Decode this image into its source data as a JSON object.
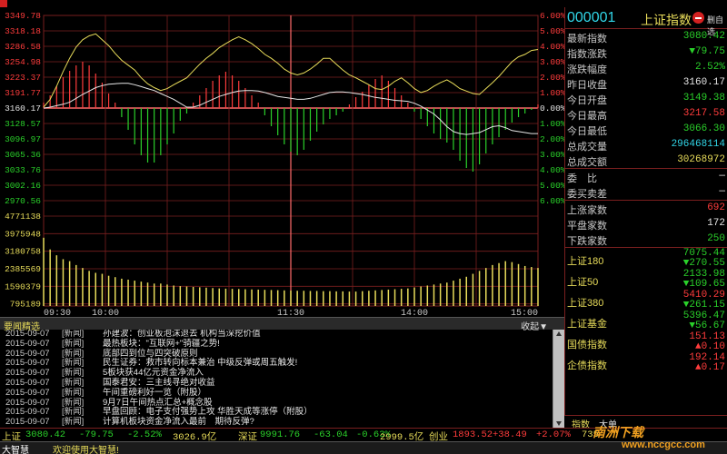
{
  "chart_data": {
    "type": "line",
    "price_axis": [
      "3349.78",
      "3318.18",
      "3286.58",
      "3254.98",
      "3223.37",
      "3191.77",
      "3160.17",
      "3128.57",
      "3096.97",
      "3065.36",
      "3033.76",
      "3002.16",
      "2970.56"
    ],
    "pct_axis": [
      "6.00%",
      "5.00%",
      "4.00%",
      "3.00%",
      "2.00%",
      "1.00%",
      "0.00%",
      "1.00%",
      "2.00%",
      "3.00%",
      "4.00%",
      "5.00%",
      "6.00%"
    ],
    "volume_axis": [
      "4771138",
      "3975948",
      "3180758",
      "2385569",
      "1590379",
      "795189"
    ],
    "time_axis": [
      "09:30",
      "10:00",
      "11:30",
      "14:00",
      "15:00"
    ],
    "ylim": [
      2970.56,
      3349.78
    ],
    "prev_close": 3160.17,
    "series": [
      {
        "values": [
          3162,
          3178,
          3205,
          3235,
          3262,
          3285,
          3300,
          3308,
          3312,
          3300,
          3288,
          3272,
          3258,
          3248,
          3238,
          3222,
          3210,
          3202,
          3196,
          3200,
          3208,
          3215,
          3222,
          3236,
          3250,
          3262,
          3272,
          3284,
          3292,
          3300,
          3306,
          3300,
          3292,
          3282,
          3270,
          3262,
          3252,
          3240,
          3232,
          3228,
          3232,
          3240,
          3250,
          3262,
          3262,
          3250,
          3238,
          3228,
          3222,
          3215,
          3208,
          3200,
          3198,
          3205,
          3215,
          3222,
          3212,
          3200,
          3192,
          3196,
          3205,
          3212,
          3218,
          3210,
          3200,
          3195,
          3190,
          3188,
          3200,
          3212,
          3225,
          3240,
          3255,
          3265,
          3270,
          3278,
          3280
        ]
      },
      {
        "values": [
          3160,
          3162,
          3165,
          3168,
          3172,
          3180,
          3188,
          3195,
          3202,
          3206,
          3209,
          3210,
          3211,
          3211,
          3208,
          3204,
          3200,
          3196,
          3190,
          3184,
          3178,
          3170,
          3162,
          3162,
          3166,
          3172,
          3178,
          3184,
          3188,
          3192,
          3195,
          3196,
          3196,
          3195,
          3192,
          3188,
          3184,
          3182,
          3180,
          3178,
          3178,
          3180,
          3184,
          3188,
          3192,
          3193,
          3193,
          3192,
          3190,
          3188,
          3185,
          3182,
          3180,
          3178,
          3176,
          3175,
          3174,
          3170,
          3164,
          3156,
          3148,
          3136,
          3122,
          3112,
          3108,
          3106,
          3108,
          3110,
          3116,
          3122,
          3124,
          3120,
          3114,
          3112,
          3110,
          3108,
          3108
        ]
      }
    ],
    "imbalance": [
      6,
      14,
      24,
      34,
      41,
      47,
      51,
      47,
      38,
      28,
      16,
      6,
      -10,
      -24,
      -40,
      -52,
      -60,
      -60,
      -52,
      -40,
      -28,
      -14,
      -6,
      6,
      14,
      22,
      30,
      36,
      40,
      36,
      30,
      22,
      14,
      6,
      -8,
      -20,
      -30,
      -40,
      -48,
      -52,
      -46,
      -36,
      -26,
      -18,
      -12,
      -8,
      -4,
      4,
      12,
      18,
      26,
      32,
      36,
      30,
      22,
      14,
      6,
      -4,
      -12,
      -20,
      -28,
      -34,
      -38,
      -46,
      -58,
      -66,
      -70,
      -62,
      -50,
      -40,
      -32,
      -24,
      -16,
      -10,
      -6,
      -2,
      4
    ],
    "volume": [
      3500000,
      2900000,
      2600000,
      2400000,
      2300000,
      2100000,
      1950000,
      1800000,
      1700000,
      1650000,
      1550000,
      1480000,
      1400000,
      1350000,
      1300000,
      1250000,
      1200000,
      1150000,
      1150000,
      1100000,
      1050000,
      1020000,
      1000000,
      980000,
      960000,
      940000,
      920000,
      900000,
      890000,
      880000,
      870000,
      860000,
      850000,
      840000,
      830000,
      820000,
      810000,
      800000,
      790000,
      780000,
      780000,
      770000,
      770000,
      760000,
      760000,
      750000,
      750000,
      740000,
      740000,
      760000,
      780000,
      800000,
      820000,
      840000,
      860000,
      880000,
      900000,
      950000,
      1000000,
      1050000,
      1100000,
      1150000,
      1200000,
      1300000,
      1400000,
      1500000,
      1650000,
      1800000,
      1950000,
      2100000,
      2200000,
      2300000,
      2250000,
      2150000,
      2050000,
      2000000,
      1950000
    ],
    "vol_ylim": [
      0,
      5400000
    ]
  },
  "quote": {
    "code": "000001",
    "name": "上证指数",
    "fav_label": "删自选",
    "stats": [
      {
        "label": "最新指数",
        "value": "3080.42",
        "color": "green"
      },
      {
        "label": "指数涨跌",
        "value": "▼79.75",
        "color": "green"
      },
      {
        "label": "涨跌幅度",
        "value": "2.52%",
        "color": "green"
      },
      {
        "label": "昨日收盘",
        "value": "3160.17",
        "color": "white"
      },
      {
        "label": "今日开盘",
        "value": "3149.38",
        "color": "green"
      },
      {
        "label": "今日最高",
        "value": "3217.58",
        "color": "red"
      },
      {
        "label": "今日最低",
        "value": "3066.30",
        "color": "green"
      },
      {
        "label": "总成交量",
        "value": "296468114",
        "color": "cyan"
      },
      {
        "label": "总成交额",
        "value": "30268972",
        "color": "yellow"
      }
    ],
    "stats2": [
      {
        "label": "委　比",
        "value": "—",
        "color": "white"
      },
      {
        "label": "委买卖差",
        "value": "—",
        "color": "white"
      }
    ],
    "stats3": [
      {
        "label": "上涨家数",
        "value": "692",
        "color": "red"
      },
      {
        "label": "平盘家数",
        "value": "172",
        "color": "white"
      },
      {
        "label": "下跌家数",
        "value": "250",
        "color": "green"
      }
    ],
    "indices": [
      {
        "name": "上证180",
        "v1": "7075.44",
        "v1c": "green",
        "v2": "▼270.55",
        "v2c": "green"
      },
      {
        "name": "上证50",
        "v1": "2133.98",
        "v1c": "green",
        "v2": "▼109.65",
        "v2c": "green"
      },
      {
        "name": "上证380",
        "v1": "5410.29",
        "v1c": "red",
        "v2": "▼261.15",
        "v2c": "green"
      },
      {
        "name": "上证基金",
        "v1": "5396.47",
        "v1c": "green",
        "v2": "▼56.67",
        "v2c": "green"
      },
      {
        "name": "国债指数",
        "v1": "151.13",
        "v1c": "red",
        "v2": "▲0.10",
        "v2c": "red"
      },
      {
        "name": "企债指数",
        "v1": "192.14",
        "v1c": "red",
        "v2": "▲0.17",
        "v2c": "red"
      }
    ],
    "tabs": [
      "指数",
      "大单"
    ]
  },
  "news": {
    "title": "要闻精选",
    "collapse_label": "收起▼",
    "items": [
      {
        "date": "2015-09-07",
        "src": "[新闻]",
        "title": "孙建波：创业板泡沫退去 机构当深挖价值"
      },
      {
        "date": "2015-09-07",
        "src": "[新闻]",
        "title": "最热板块：\"互联网+\"骑疆之势!"
      },
      {
        "date": "2015-09-07",
        "src": "[新闻]",
        "title": "底部四到位与四突破原则"
      },
      {
        "date": "2015-09-07",
        "src": "[新闻]",
        "title": "民生证券：救市转向标本兼治 中级反弹或周五触发!"
      },
      {
        "date": "2015-09-07",
        "src": "[新闻]",
        "title": "5板块获44亿元资金净流入"
      },
      {
        "date": "2015-09-07",
        "src": "[新闻]",
        "title": "国泰君安：三主线寻绝对收益"
      },
      {
        "date": "2015-09-07",
        "src": "[新闻]",
        "title": "午间重磅利好一览（附股）"
      },
      {
        "date": "2015-09-07",
        "src": "[新闻]",
        "title": "9月7日午间热点汇总+概念股"
      },
      {
        "date": "2015-09-07",
        "src": "[新闻]",
        "title": "早盘回顾：电子支付强势上攻 华胜天成等涨停（附股）"
      },
      {
        "date": "2015-09-07",
        "src": "[新闻]",
        "title": "计算机板块资金净流入最前　期待反弹?"
      }
    ]
  },
  "ticker": [
    {
      "text": "上证",
      "color": "yellow"
    },
    {
      "text": "3080.42",
      "color": "green"
    },
    {
      "text": "-79.75",
      "color": "green"
    },
    {
      "text": "-2.52%",
      "color": "green"
    },
    {
      "text": "3026.9亿",
      "color": "yellow"
    },
    {
      "text": "深证",
      "color": "yellow"
    },
    {
      "text": "9991.76",
      "color": "green"
    },
    {
      "text": "-63.04",
      "color": "green"
    },
    {
      "text": "-0.63%",
      "color": "green"
    },
    {
      "text": "2999.5亿",
      "color": "yellow"
    },
    {
      "text": "创业",
      "color": "yellow"
    },
    {
      "text": "1893.52",
      "color": "red"
    },
    {
      "text": "+38.49",
      "color": "red"
    },
    {
      "text": "+2.07%",
      "color": "red"
    },
    {
      "text": "735",
      "color": "yellow"
    }
  ],
  "status": {
    "logo": "大智慧",
    "message": "欢迎使用大智慧!"
  },
  "watermark": {
    "main": "南洲下载",
    "sub": "www.nccgcc.com"
  },
  "colors": {
    "grid": "#7a1f1f",
    "price": "#e6e6e6",
    "avg": "#e8dc5a",
    "up": "#ff3c3c",
    "down": "#2ad02a",
    "volume": "#e8dc5a"
  }
}
